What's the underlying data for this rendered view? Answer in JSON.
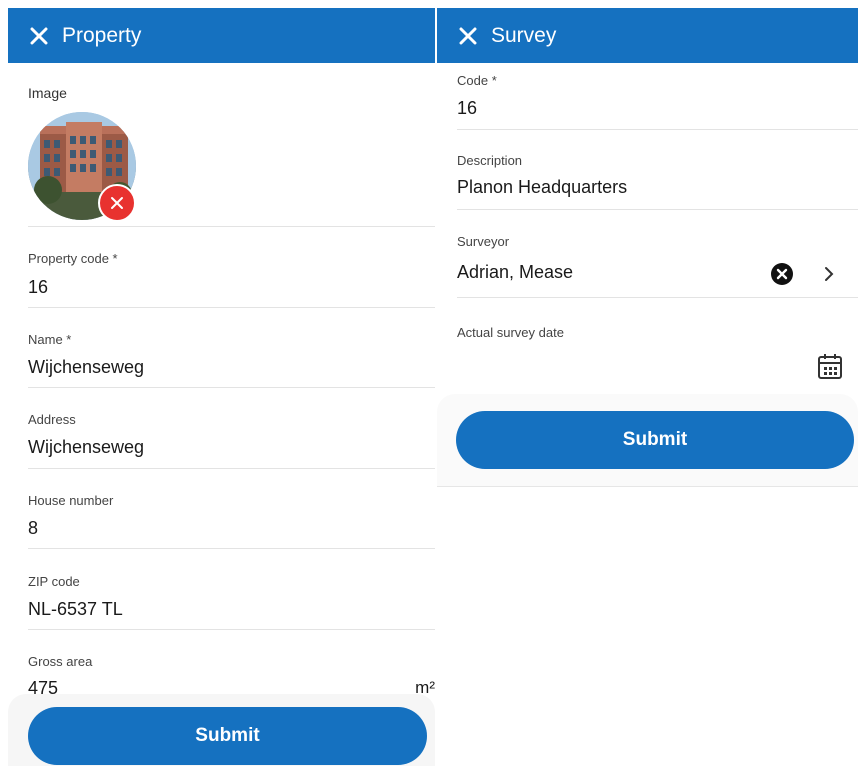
{
  "property": {
    "title": "Property",
    "image_label": "Image",
    "fields": {
      "property_code": {
        "label": "Property code *",
        "value": "16"
      },
      "name": {
        "label": "Name *",
        "value": "Wijchenseweg"
      },
      "address": {
        "label": "Address",
        "value": "Wijchenseweg"
      },
      "house_number": {
        "label": "House number",
        "value": "8"
      },
      "zip_code": {
        "label": "ZIP code",
        "value": "NL-6537 TL"
      },
      "gross_area": {
        "label": "Gross area",
        "value": "475",
        "unit": "m²"
      }
    },
    "submit_label": "Submit"
  },
  "survey": {
    "title": "Survey",
    "fields": {
      "code": {
        "label": "Code *",
        "value": "16"
      },
      "description": {
        "label": "Description",
        "value": "Planon Headquarters"
      },
      "surveyor": {
        "label": "Surveyor",
        "value": "Adrian, Mease"
      },
      "actual_survey_date": {
        "label": "Actual survey date",
        "value": ""
      }
    },
    "submit_label": "Submit"
  },
  "colors": {
    "header": "#1571c0",
    "button": "#1571c0",
    "remove": "#e8322f"
  },
  "icons": [
    "close-icon",
    "remove-image-icon",
    "clear-icon",
    "chevron-right-icon",
    "calendar-icon"
  ]
}
